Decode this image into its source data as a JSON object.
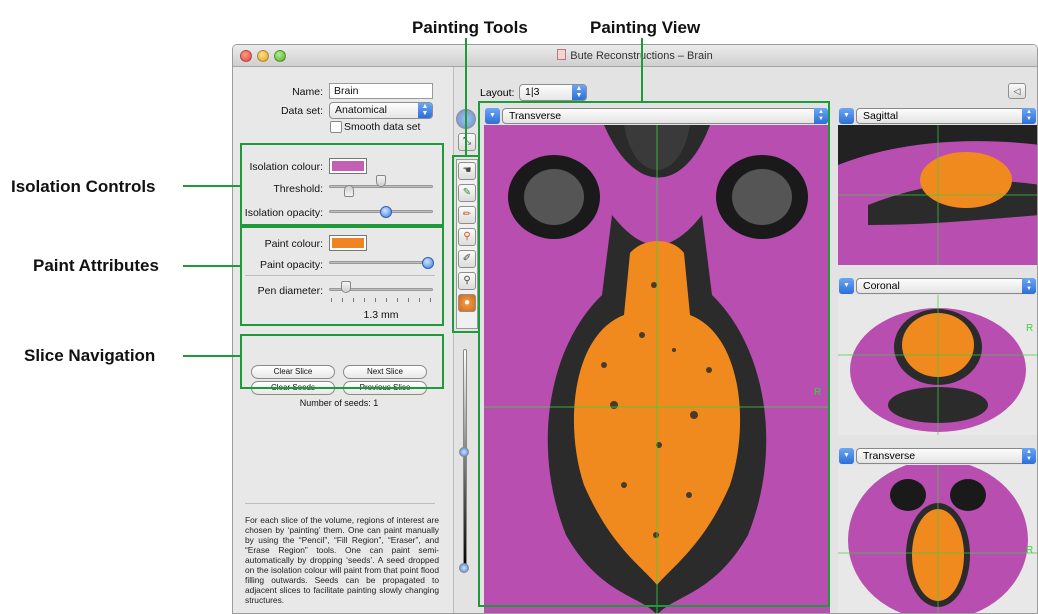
{
  "callouts": {
    "painting_tools": "Painting Tools",
    "painting_view": "Painting View",
    "isolation_controls": "Isolation Controls",
    "paint_attributes": "Paint Attributes",
    "slice_navigation": "Slice Navigation"
  },
  "window": {
    "title": "Bute Reconstructions – Brain"
  },
  "left": {
    "name_label": "Name:",
    "name_value": "Brain",
    "dataset_label": "Data set:",
    "dataset_value": "Anatomical",
    "smooth_label": "Smooth data set",
    "smooth_checked": false,
    "isolation_colour_label": "Isolation colour:",
    "isolation_colour": "#c45fb4",
    "threshold_label": "Threshold:",
    "isolation_opacity_label": "Isolation opacity:",
    "paint_colour_label": "Paint colour:",
    "paint_colour": "#ee8422",
    "paint_opacity_label": "Paint opacity:",
    "pen_diameter_label": "Pen diameter:",
    "pen_diameter_value": "1.3 mm",
    "clear_slice": "Clear Slice",
    "next_slice": "Next Slice",
    "clear_seeds": "Clear Seeds",
    "previous_slice": "Previous Slice",
    "seeds_label": "Number of seeds:  1",
    "description": "For each slice of the volume, regions of interest are chosen by ‘painting’ them. One can paint manually by using the “Pencil”, “Fill Region”, “Eraser”, and “Erase Region” tools. One can paint semi-automatically by dropping ‘seeds’. A seed dropped on the isolation colour will paint from that point flood filling outwards. Seeds can be propagated to adjacent slices to facilitate painting slowly changing structures."
  },
  "right": {
    "layout_label": "Layout:",
    "layout_value": "1|3",
    "main_view": "Transverse",
    "view_sagittal": "Sagittal",
    "view_coronal": "Coronal",
    "view_transverse_small": "Transverse",
    "orient_r": "R",
    "orient_r2": "R",
    "orient_r3": "R"
  },
  "colors": {
    "highlight": "#1f9a3a",
    "tissue": "#b84fb0",
    "brain": "#f08a1e"
  }
}
